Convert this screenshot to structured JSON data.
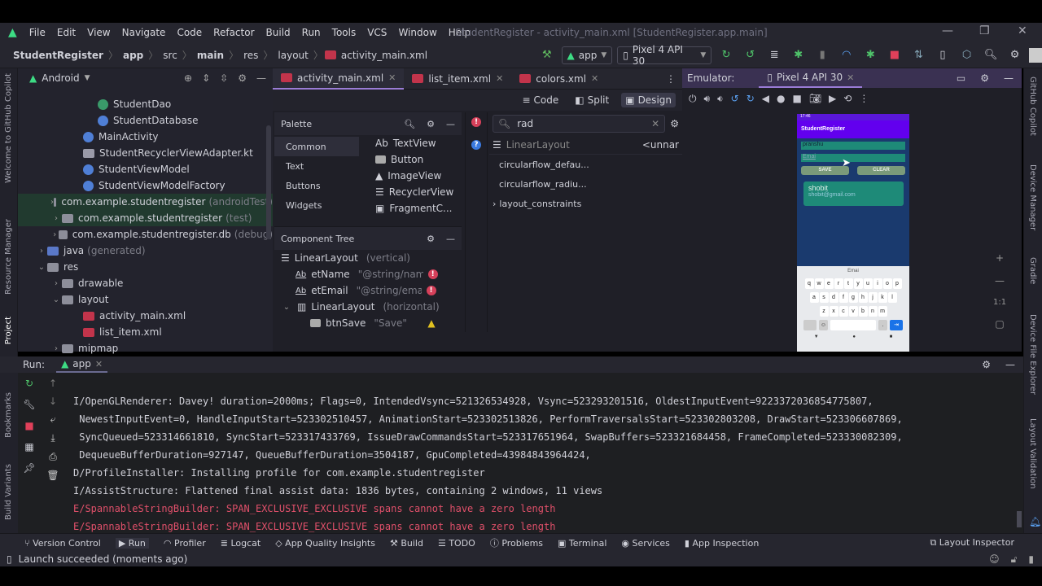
{
  "menu": [
    "File",
    "Edit",
    "View",
    "Navigate",
    "Code",
    "Refactor",
    "Build",
    "Run",
    "Tools",
    "VCS",
    "Window",
    "Help"
  ],
  "window_title": "StudentRegister - activity_main.xml [StudentRegister.app.main]",
  "breadcrumb": [
    "StudentRegister",
    "app",
    "src",
    "main",
    "res",
    "layout",
    "activity_main.xml"
  ],
  "toolbar": {
    "run_config": "app",
    "device": "Pixel 4 API 30"
  },
  "left_stripe": [
    "Welcome to GitHub Copilot",
    "Resource Manager",
    "Project",
    "Bookmarks",
    "Build Variants"
  ],
  "right_stripe": [
    "GitHub Copilot",
    "Device Manager",
    "Gradle",
    "Device File Explorer",
    "Layout Validation"
  ],
  "project": {
    "view": "Android",
    "items": [
      {
        "label": "StudentDao",
        "type": "kotlin"
      },
      {
        "label": "StudentDatabase",
        "type": "kotlin"
      },
      {
        "label": "MainActivity",
        "type": "kotlin"
      },
      {
        "label": "StudentRecyclerViewAdapter.kt",
        "type": "file"
      },
      {
        "label": "StudentViewModel",
        "type": "kotlin"
      },
      {
        "label": "StudentViewModelFactory",
        "type": "kotlin"
      },
      {
        "label": "com.example.studentregister",
        "suffix": "(androidTest)",
        "type": "folder"
      },
      {
        "label": "com.example.studentregister",
        "suffix": "(test)",
        "type": "folder"
      },
      {
        "label": "com.example.studentregister.db",
        "suffix": "(debug)",
        "type": "folder"
      },
      {
        "label": "java",
        "suffix": "(generated)",
        "type": "folder"
      },
      {
        "label": "res",
        "type": "folder"
      },
      {
        "label": "drawable",
        "type": "folder"
      },
      {
        "label": "layout",
        "type": "folder"
      },
      {
        "label": "activity_main.xml",
        "type": "xml"
      },
      {
        "label": "list_item.xml",
        "type": "xml"
      },
      {
        "label": "mipmap",
        "type": "folder"
      }
    ]
  },
  "editor": {
    "tabs": [
      "activity_main.xml",
      "list_item.xml",
      "colors.xml"
    ],
    "modes": [
      "Code",
      "Split",
      "Design"
    ],
    "palette": {
      "title": "Palette",
      "categories": [
        "Common",
        "Text",
        "Buttons",
        "Widgets"
      ],
      "widgets": [
        "TextView",
        "Button",
        "ImageView",
        "RecyclerView",
        "FragmentC..."
      ]
    },
    "component_tree": {
      "title": "Component Tree",
      "items": [
        {
          "name": "LinearLayout",
          "hint": "(vertical)"
        },
        {
          "name": "etName",
          "hint": "\"@string/nam...",
          "status": "error"
        },
        {
          "name": "etEmail",
          "hint": "\"@string/email\"",
          "status": "error"
        },
        {
          "name": "LinearLayout",
          "hint": "(horizontal)"
        },
        {
          "name": "btnSave",
          "hint": "\"Save\"",
          "status": "warning"
        }
      ]
    },
    "attributes": {
      "search": "rad",
      "component": "LinearLayout",
      "id": "<unnar",
      "rows": [
        "circularflow_defau...",
        "circularflow_radiu...",
        "layout_constraints"
      ]
    }
  },
  "emulator": {
    "label": "Emulator:",
    "tab": "Pixel 4 API 30",
    "zoom_label": "1:1",
    "phone": {
      "time": "17:46",
      "app_title": "StudentRegister",
      "name_value": "pranshu",
      "email_value": "Emai",
      "save": "SAVE",
      "clear": "CLEAR",
      "card_name": "shobit",
      "card_email": "shobit@gmail.com",
      "suggestion": "Emai",
      "keys_row1": [
        "q",
        "w",
        "e",
        "r",
        "t",
        "y",
        "u",
        "i",
        "o",
        "p"
      ],
      "keys_row2": [
        "a",
        "s",
        "d",
        "f",
        "g",
        "h",
        "j",
        "k",
        "l"
      ],
      "keys_row3": [
        "z",
        "x",
        "c",
        "v",
        "b",
        "n",
        "m"
      ]
    }
  },
  "run": {
    "label": "Run:",
    "tab": "app",
    "log": [
      {
        "level": "info",
        "text": "I/OpenGLRenderer: Davey! duration=2000ms; Flags=0, IntendedVsync=521326534928, Vsync=523293201516, OldestInputEvent=9223372036854775807,"
      },
      {
        "level": "info",
        "text": " NewestInputEvent=0, HandleInputStart=523302510457, AnimationStart=523302513826, PerformTraversalsStart=523302803208, DrawStart=523306607869,"
      },
      {
        "level": "info",
        "text": " SyncQueued=523314661810, SyncStart=523317433769, IssueDrawCommandsStart=523317651964, SwapBuffers=523321684458, FrameCompleted=523330082309,"
      },
      {
        "level": "info",
        "text": " DequeueBufferDuration=927147, QueueBufferDuration=3504187, GpuCompleted=43984843964424,"
      },
      {
        "level": "info",
        "text": "D/ProfileInstaller: Installing profile for com.example.studentregister"
      },
      {
        "level": "info",
        "text": "I/AssistStructure: Flattened final assist data: 1836 bytes, containing 2 windows, 11 views"
      },
      {
        "level": "error",
        "text": "E/SpannableStringBuilder: SPAN_EXCLUSIVE_EXCLUSIVE spans cannot have a zero length"
      },
      {
        "level": "error",
        "text": "E/SpannableStringBuilder: SPAN_EXCLUSIVE_EXCLUSIVE spans cannot have a zero length"
      }
    ]
  },
  "bottom_tools": [
    "Version Control",
    "Run",
    "Profiler",
    "Logcat",
    "App Quality Insights",
    "Build",
    "TODO",
    "Problems",
    "Terminal",
    "Services",
    "App Inspection"
  ],
  "layout_inspector": "Layout Inspector",
  "status": "Launch succeeded (moments ago)",
  "colors": {
    "accent": "#9a7cd6",
    "error": "#e0506a",
    "app_bar": "#6200ee",
    "phone_bg": "#1a3a6e",
    "input": "#1e8a78",
    "button": "#7a9a7a"
  }
}
